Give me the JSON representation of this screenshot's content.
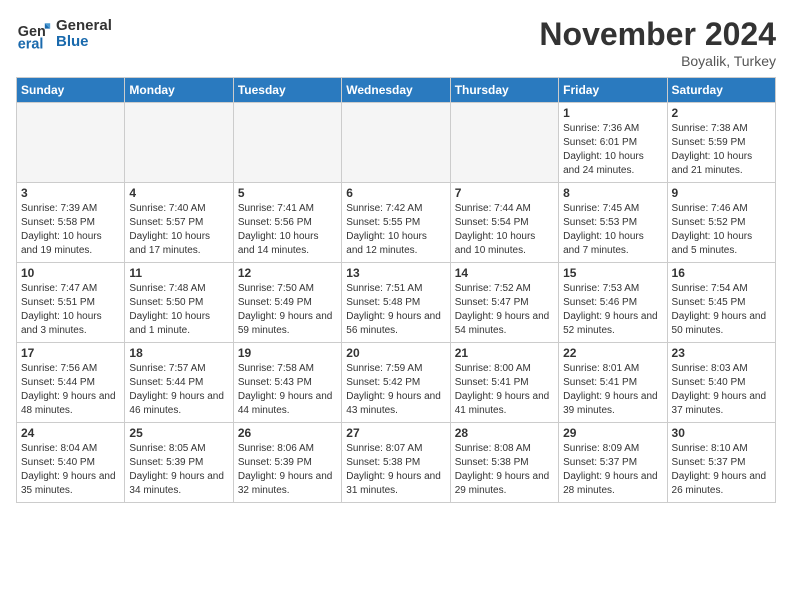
{
  "header": {
    "logo_line1": "General",
    "logo_line2": "Blue",
    "month": "November 2024",
    "location": "Boyalik, Turkey"
  },
  "weekdays": [
    "Sunday",
    "Monday",
    "Tuesday",
    "Wednesday",
    "Thursday",
    "Friday",
    "Saturday"
  ],
  "weeks": [
    [
      {
        "day": "",
        "info": ""
      },
      {
        "day": "",
        "info": ""
      },
      {
        "day": "",
        "info": ""
      },
      {
        "day": "",
        "info": ""
      },
      {
        "day": "",
        "info": ""
      },
      {
        "day": "1",
        "info": "Sunrise: 7:36 AM\nSunset: 6:01 PM\nDaylight: 10 hours and 24 minutes."
      },
      {
        "day": "2",
        "info": "Sunrise: 7:38 AM\nSunset: 5:59 PM\nDaylight: 10 hours and 21 minutes."
      }
    ],
    [
      {
        "day": "3",
        "info": "Sunrise: 7:39 AM\nSunset: 5:58 PM\nDaylight: 10 hours and 19 minutes."
      },
      {
        "day": "4",
        "info": "Sunrise: 7:40 AM\nSunset: 5:57 PM\nDaylight: 10 hours and 17 minutes."
      },
      {
        "day": "5",
        "info": "Sunrise: 7:41 AM\nSunset: 5:56 PM\nDaylight: 10 hours and 14 minutes."
      },
      {
        "day": "6",
        "info": "Sunrise: 7:42 AM\nSunset: 5:55 PM\nDaylight: 10 hours and 12 minutes."
      },
      {
        "day": "7",
        "info": "Sunrise: 7:44 AM\nSunset: 5:54 PM\nDaylight: 10 hours and 10 minutes."
      },
      {
        "day": "8",
        "info": "Sunrise: 7:45 AM\nSunset: 5:53 PM\nDaylight: 10 hours and 7 minutes."
      },
      {
        "day": "9",
        "info": "Sunrise: 7:46 AM\nSunset: 5:52 PM\nDaylight: 10 hours and 5 minutes."
      }
    ],
    [
      {
        "day": "10",
        "info": "Sunrise: 7:47 AM\nSunset: 5:51 PM\nDaylight: 10 hours and 3 minutes."
      },
      {
        "day": "11",
        "info": "Sunrise: 7:48 AM\nSunset: 5:50 PM\nDaylight: 10 hours and 1 minute."
      },
      {
        "day": "12",
        "info": "Sunrise: 7:50 AM\nSunset: 5:49 PM\nDaylight: 9 hours and 59 minutes."
      },
      {
        "day": "13",
        "info": "Sunrise: 7:51 AM\nSunset: 5:48 PM\nDaylight: 9 hours and 56 minutes."
      },
      {
        "day": "14",
        "info": "Sunrise: 7:52 AM\nSunset: 5:47 PM\nDaylight: 9 hours and 54 minutes."
      },
      {
        "day": "15",
        "info": "Sunrise: 7:53 AM\nSunset: 5:46 PM\nDaylight: 9 hours and 52 minutes."
      },
      {
        "day": "16",
        "info": "Sunrise: 7:54 AM\nSunset: 5:45 PM\nDaylight: 9 hours and 50 minutes."
      }
    ],
    [
      {
        "day": "17",
        "info": "Sunrise: 7:56 AM\nSunset: 5:44 PM\nDaylight: 9 hours and 48 minutes."
      },
      {
        "day": "18",
        "info": "Sunrise: 7:57 AM\nSunset: 5:44 PM\nDaylight: 9 hours and 46 minutes."
      },
      {
        "day": "19",
        "info": "Sunrise: 7:58 AM\nSunset: 5:43 PM\nDaylight: 9 hours and 44 minutes."
      },
      {
        "day": "20",
        "info": "Sunrise: 7:59 AM\nSunset: 5:42 PM\nDaylight: 9 hours and 43 minutes."
      },
      {
        "day": "21",
        "info": "Sunrise: 8:00 AM\nSunset: 5:41 PM\nDaylight: 9 hours and 41 minutes."
      },
      {
        "day": "22",
        "info": "Sunrise: 8:01 AM\nSunset: 5:41 PM\nDaylight: 9 hours and 39 minutes."
      },
      {
        "day": "23",
        "info": "Sunrise: 8:03 AM\nSunset: 5:40 PM\nDaylight: 9 hours and 37 minutes."
      }
    ],
    [
      {
        "day": "24",
        "info": "Sunrise: 8:04 AM\nSunset: 5:40 PM\nDaylight: 9 hours and 35 minutes."
      },
      {
        "day": "25",
        "info": "Sunrise: 8:05 AM\nSunset: 5:39 PM\nDaylight: 9 hours and 34 minutes."
      },
      {
        "day": "26",
        "info": "Sunrise: 8:06 AM\nSunset: 5:39 PM\nDaylight: 9 hours and 32 minutes."
      },
      {
        "day": "27",
        "info": "Sunrise: 8:07 AM\nSunset: 5:38 PM\nDaylight: 9 hours and 31 minutes."
      },
      {
        "day": "28",
        "info": "Sunrise: 8:08 AM\nSunset: 5:38 PM\nDaylight: 9 hours and 29 minutes."
      },
      {
        "day": "29",
        "info": "Sunrise: 8:09 AM\nSunset: 5:37 PM\nDaylight: 9 hours and 28 minutes."
      },
      {
        "day": "30",
        "info": "Sunrise: 8:10 AM\nSunset: 5:37 PM\nDaylight: 9 hours and 26 minutes."
      }
    ]
  ]
}
